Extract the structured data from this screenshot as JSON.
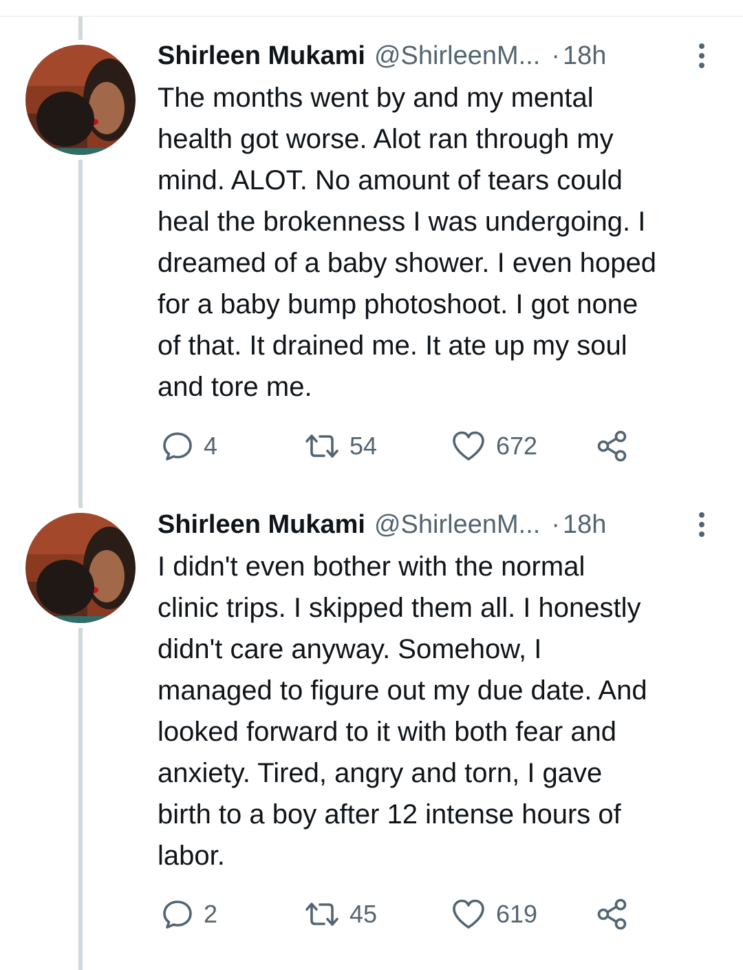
{
  "tweets": [
    {
      "author_name": "Shirleen Mukami",
      "handle": "@ShirleenM...",
      "separator": "·",
      "time": "18h",
      "lines": [
        "The months went by and my mental",
        "health got worse. Alot ran through my",
        "mind. ALOT. No amount of tears could",
        "heal the brokenness I was undergoing. I",
        "dreamed of a baby shower. I even hoped",
        "for a baby bump photoshoot. I got none",
        "of that. It drained me. It ate up my soul",
        "and tore me."
      ],
      "replies": "4",
      "retweets": "54",
      "likes": "672"
    },
    {
      "author_name": "Shirleen Mukami",
      "handle": "@ShirleenM...",
      "separator": "·",
      "time": "18h",
      "lines": [
        "I didn't even bother with the normal",
        "clinic trips. I skipped them all. I honestly",
        "didn't care anyway. Somehow, I",
        "managed to figure out my due date. And",
        "looked forward to it with both fear and",
        "anxiety. Tired, angry and torn, I gave",
        "birth to a boy after 12 intense hours of",
        "labor."
      ],
      "replies": "2",
      "retweets": "45",
      "likes": "619"
    }
  ],
  "icons": {
    "reply": "reply-icon",
    "retweet": "retweet-icon",
    "like": "heart-icon",
    "share": "share-icon",
    "more": "more-options-icon"
  },
  "colors": {
    "text": "#0f1419",
    "secondary": "#536471",
    "thread_line": "#cfd9de"
  }
}
